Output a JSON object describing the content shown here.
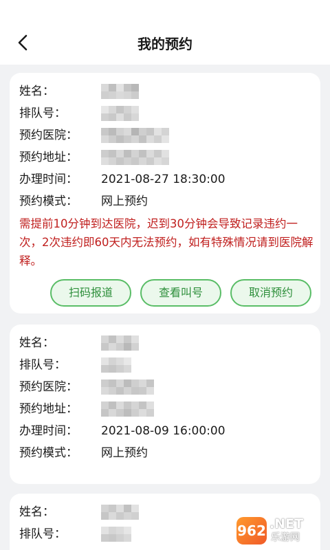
{
  "header": {
    "title": "我的预约",
    "back_icon": "chevron-left-icon"
  },
  "labels": {
    "name": "姓名：",
    "queue": "排队号：",
    "hospital": "预约医院：",
    "address": "预约地址：",
    "time": "办理时间：",
    "mode": "预约模式："
  },
  "appointments": [
    {
      "time": "2021-08-27 18:30:00",
      "mode": "网上预约",
      "notice": "需提前10分钟到达医院，迟到30分钟会导致记录违约一次，2次违约即60天内无法预约，如有特殊情况请到医院解释。",
      "buttons": [
        "扫码报道",
        "查看叫号",
        "取消预约"
      ]
    },
    {
      "time": "2021-08-09 16:00:00",
      "mode": "网上预约"
    },
    {}
  ],
  "colors": {
    "notice_red": "#c0201f",
    "button_green": "#59bd66",
    "page_bg": "#f1f2f4"
  },
  "watermark": {
    "badge": "962",
    "net": ".NET",
    "sub": "乐游网"
  }
}
